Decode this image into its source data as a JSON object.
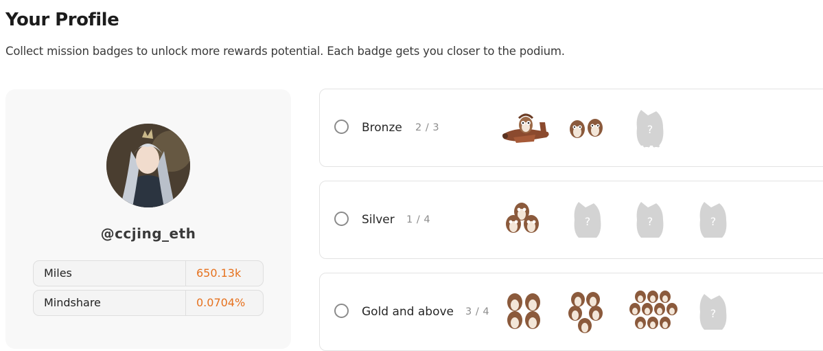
{
  "page": {
    "title": "Your Profile",
    "subtitle": "Collect mission badges to unlock more rewards potential. Each badge gets you closer to the podium."
  },
  "profile": {
    "username": "@ccjing_eth",
    "stats": [
      {
        "label": "Miles",
        "value": "650.13k"
      },
      {
        "label": "Mindshare",
        "value": "0.0704%"
      }
    ]
  },
  "tiers": [
    {
      "name": "Bronze",
      "progress": "2 / 3",
      "badges": [
        {
          "icon": "owl-pilot-plane-badge-icon",
          "earned": true
        },
        {
          "icon": "owl-pair-badge-icon",
          "earned": true
        },
        {
          "icon": "locked-owl-badge-icon",
          "earned": false
        }
      ]
    },
    {
      "name": "Silver",
      "progress": "1 / 4",
      "badges": [
        {
          "icon": "owl-trio-badge-icon",
          "earned": true
        },
        {
          "icon": "locked-owl-badge-icon",
          "earned": false
        },
        {
          "icon": "locked-owl-badge-icon",
          "earned": false
        },
        {
          "icon": "locked-owl-badge-icon",
          "earned": false
        }
      ]
    },
    {
      "name": "Gold and above",
      "progress": "3 / 4",
      "badges": [
        {
          "icon": "owl-group-badge-icon",
          "earned": true
        },
        {
          "icon": "owl-flock-badge-icon",
          "earned": true
        },
        {
          "icon": "owl-crowd-badge-icon",
          "earned": true
        },
        {
          "icon": "locked-owl-badge-icon",
          "earned": false
        }
      ]
    }
  ],
  "colors": {
    "accent": "#e6711d",
    "owl_brown": "#8b5a3c",
    "locked_gray": "#d3d3d3"
  }
}
